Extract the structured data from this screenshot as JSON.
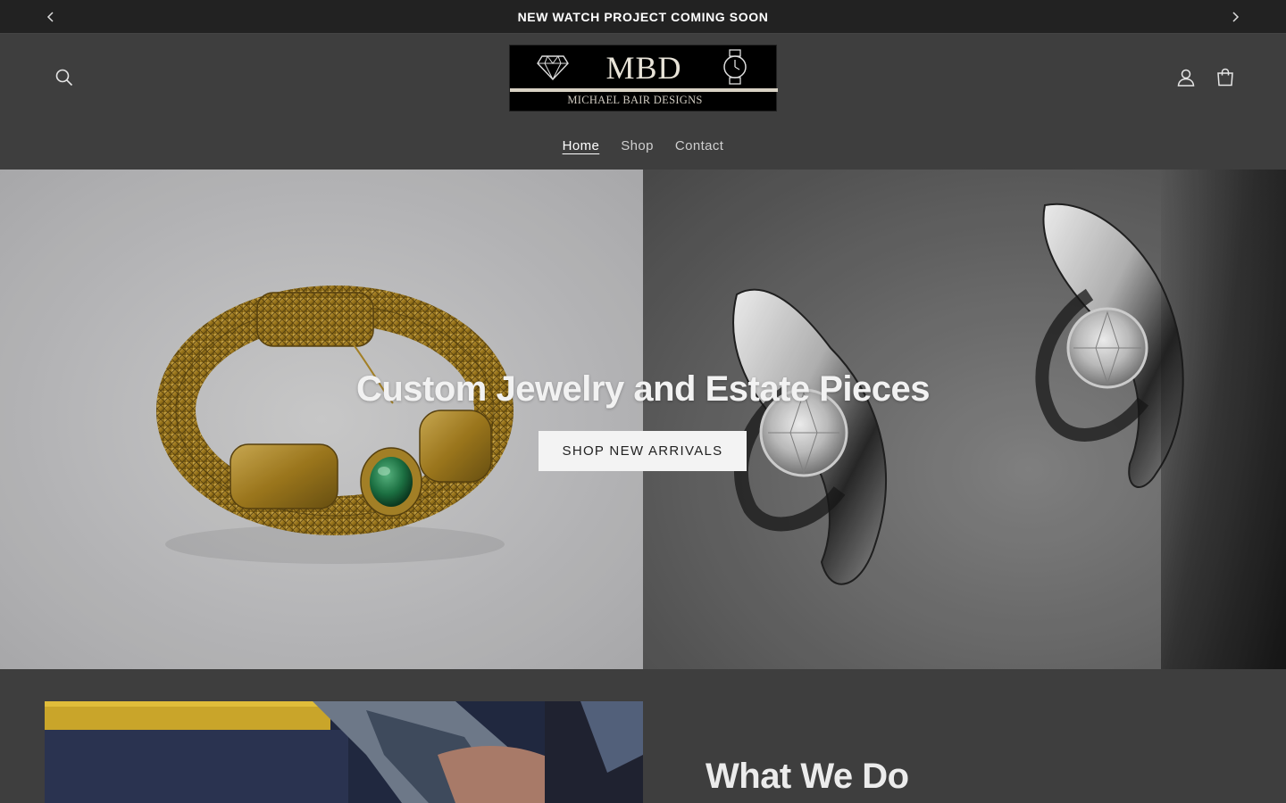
{
  "announcement": {
    "message": "NEW WATCH PROJECT COMING SOON",
    "prev_icon": "chevron-left-icon",
    "next_icon": "chevron-right-icon"
  },
  "header": {
    "logo": {
      "monogram": "MBD",
      "subtitle": "MICHAEL BAIR DESIGNS",
      "left_emblem": "diamond-icon",
      "right_emblem": "watch-icon"
    },
    "search_icon": "search-icon",
    "account_icon": "account-icon",
    "cart_icon": "cart-icon"
  },
  "nav": {
    "items": [
      {
        "label": "Home",
        "active": true
      },
      {
        "label": "Shop",
        "active": false
      },
      {
        "label": "Contact",
        "active": false
      }
    ]
  },
  "hero": {
    "title": "Custom Jewelry and Estate Pieces",
    "cta_label": "SHOP NEW ARRIVALS"
  },
  "about": {
    "title": "What We Do"
  },
  "colors": {
    "page_bg": "#3e3e3e",
    "announcement_bg": "#222222",
    "cta_bg": "#f3f3f3",
    "cta_text": "#222222",
    "gold": "#b8902e",
    "emerald": "#1f7a48"
  }
}
